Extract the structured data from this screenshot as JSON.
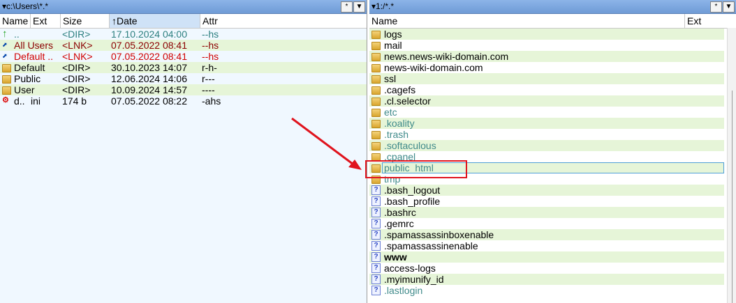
{
  "left": {
    "path": "c:\\Users\\*.*",
    "btn_star": "*",
    "btn_down": "▼",
    "columns": {
      "name": "Name",
      "ext": "Ext",
      "size": "Size",
      "date": "Date",
      "attr": "Attr"
    },
    "sort_arrow": "↑",
    "rows": [
      {
        "icon": "up-arrow-icon",
        "name": "..",
        "ext": "",
        "size": "<DIR>",
        "date": "17.10.2024 04:00",
        "attr": "--hs",
        "color": "teal"
      },
      {
        "icon": "shortcut-icon",
        "name": "All Users",
        "ext": "",
        "size": "<LNK>",
        "date": "07.05.2022 08:41",
        "attr": "--hs",
        "color": "maroon"
      },
      {
        "icon": "shortcut-icon",
        "name": "Default ..",
        "ext": "",
        "size": "<LNK>",
        "date": "07.05.2022 08:41",
        "attr": "--hs",
        "color": "red"
      },
      {
        "icon": "folder-icon",
        "name": "Default",
        "ext": "",
        "size": "<DIR>",
        "date": "30.10.2023 14:07",
        "attr": "r-h-",
        "color": "dark"
      },
      {
        "icon": "folder-icon",
        "name": "Public",
        "ext": "",
        "size": "<DIR>",
        "date": "12.06.2024 14:06",
        "attr": "r---",
        "color": "dark"
      },
      {
        "icon": "folder-icon",
        "name": "User",
        "ext": "",
        "size": "<DIR>",
        "date": "10.09.2024 14:57",
        "attr": "----",
        "color": "dark"
      },
      {
        "icon": "ini-file-icon",
        "name": "d.. ",
        "ext": "ini",
        "size": "174 b",
        "date": "07.05.2022 08:22",
        "attr": "-ahs",
        "color": "dark"
      }
    ]
  },
  "right": {
    "path": "1:/*.*",
    "btn_star": "*",
    "btn_down": "▼",
    "columns": {
      "name": "Name",
      "ext": "Ext"
    },
    "rows": [
      {
        "icon": "folder-icon",
        "name": "logs",
        "color": "dark"
      },
      {
        "icon": "folder-icon",
        "name": "mail",
        "color": "dark"
      },
      {
        "icon": "folder-icon",
        "name": "news.news-wiki-domain.com",
        "color": "dark"
      },
      {
        "icon": "folder-icon",
        "name": "news-wiki-domain.com",
        "color": "dark"
      },
      {
        "icon": "folder-icon",
        "name": "ssl",
        "color": "dark"
      },
      {
        "icon": "folder-icon",
        "name": ".cagefs",
        "color": "dark"
      },
      {
        "icon": "folder-icon",
        "name": ".cl.selector",
        "color": "dark"
      },
      {
        "icon": "folder-icon",
        "name": "etc",
        "color": "hidden"
      },
      {
        "icon": "folder-icon",
        "name": ".koality",
        "color": "hidden"
      },
      {
        "icon": "folder-icon",
        "name": ".trash",
        "color": "hidden"
      },
      {
        "icon": "folder-icon",
        "name": ".softaculous",
        "color": "hidden"
      },
      {
        "icon": "folder-icon",
        "name": ".cpanel",
        "color": "hidden"
      },
      {
        "icon": "folder-icon",
        "name": "public_html",
        "color": "hidden",
        "focused": true
      },
      {
        "icon": "folder-icon",
        "name": "tmp",
        "color": "hidden"
      },
      {
        "icon": "unknown-file-icon",
        "name": ".bash_logout",
        "color": "dark"
      },
      {
        "icon": "unknown-file-icon",
        "name": ".bash_profile",
        "color": "dark"
      },
      {
        "icon": "unknown-file-icon",
        "name": ".bashrc",
        "color": "dark"
      },
      {
        "icon": "unknown-file-icon",
        "name": ".gemrc",
        "color": "dark"
      },
      {
        "icon": "unknown-file-icon",
        "name": ".spamassassinboxenable",
        "color": "dark"
      },
      {
        "icon": "unknown-file-icon",
        "name": ".spamassassinenable",
        "color": "dark"
      },
      {
        "icon": "unknown-file-icon",
        "name": "www",
        "color": "dark",
        "bold": true
      },
      {
        "icon": "unknown-file-icon",
        "name": "access-logs",
        "color": "dark"
      },
      {
        "icon": "unknown-file-icon",
        "name": ".myimunify_id",
        "color": "dark"
      },
      {
        "icon": "unknown-file-icon",
        "name": ".lastlogin",
        "color": "hidden"
      }
    ]
  },
  "colors": {
    "annotation": "#e0141e",
    "stripe": "#e6f5d8",
    "path_bar": "#6f9bd6"
  }
}
